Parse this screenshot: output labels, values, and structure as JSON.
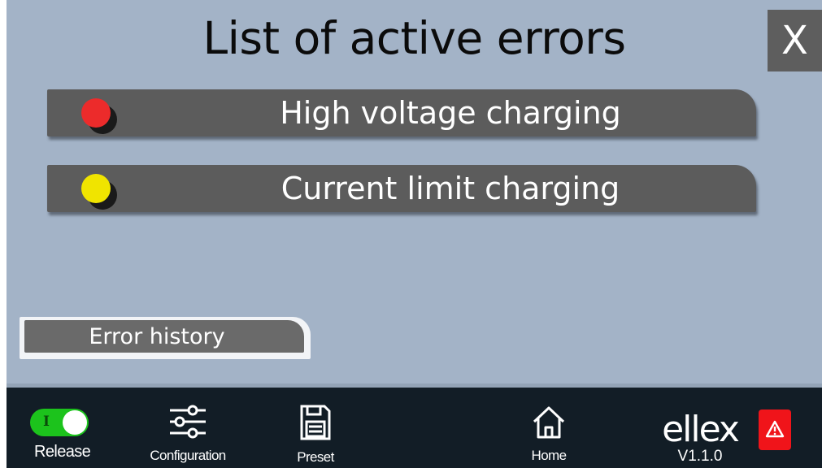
{
  "header": {
    "title": "List of active errors",
    "close_label": "X"
  },
  "errors": [
    {
      "label": "High voltage charging",
      "led_color": "#ec2b2b",
      "severity": "red"
    },
    {
      "label": "Current limit charging",
      "led_color": "#f0e400",
      "severity": "yellow"
    }
  ],
  "error_history_button": {
    "label": "Error history"
  },
  "footer": {
    "release": {
      "label": "Release",
      "toggle_mark": "I",
      "toggle_on": true,
      "toggle_color": "#1cc31c"
    },
    "configuration": {
      "label": "Configuration",
      "icon": "sliders-icon"
    },
    "preset": {
      "label": "Preset",
      "icon": "save-document-icon"
    },
    "home": {
      "label": "Home",
      "icon": "home-icon"
    },
    "brand": {
      "logo": "ellex",
      "version": "V1.1.0"
    },
    "alert": {
      "icon": "warning-icon",
      "color": "#f0141a"
    }
  },
  "colors": {
    "background": "#a3b3c7",
    "row": "#5c5c5c",
    "footer": "#121d26",
    "close": "#5e5e5e"
  }
}
